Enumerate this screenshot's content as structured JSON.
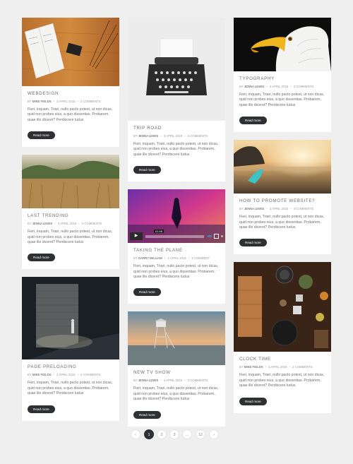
{
  "posts": [
    {
      "title": "Webdesign",
      "author": "MIKE FIELDS",
      "date": "3 APRIL 2015",
      "comments": "2 COMMENTS",
      "excerpt": "Fieri, inquam, Triari, nullo pacto potest, ut non dicas, quid non probes eius, a quo dissentias. Probarem, quae ille diceret? Perdiscere ludus",
      "button": "Read more"
    },
    {
      "title": "Last Trending",
      "author": "JENNA LEWIS",
      "date": "3 APRIL 2015",
      "comments": "3 COMMENTS",
      "excerpt": "Fieri, inquam, Triari, nullo pacto potest, ut non dicas, quid non probes eius, a quo dissentias. Probarem, quae ille diceret? Perdiscere ludus",
      "button": "Read more"
    },
    {
      "title": "Page Preloading",
      "author": "MIKE FIELDS",
      "date": "3 APRIL 2015",
      "comments": "2 COMMENTS",
      "excerpt": "Fieri, inquam, Triari, nullo pacto potest, ut non dicas, quid non probes eius, a quo dissentias. Probarem, quae ille diceret? Perdiscere ludus",
      "button": "Read more"
    },
    {
      "title": "Trip Road",
      "author": "JENNA LEWIS",
      "date": "3 APRIL 2015",
      "comments": "3 COMMENTS",
      "excerpt": "Fieri, inquam, Triari, nullo pacto potest, ut non dicas, quid non probes eius, a quo dissentias. Probarem, quae ille diceret? Perdiscere ludus",
      "button": "Read more"
    },
    {
      "title": "Taking the Plane",
      "author": "GARRY WILLIAM",
      "date": "2 APRIL 2015",
      "comments": "1 COMMENT",
      "excerpt": "Fieri, inquam, Triari, nullo pacto potest, ut non dicas, quid non probes eius, a quo dissentias. Probarem, quae ille diceret? Perdiscere ludus",
      "button": "Read more",
      "video": {
        "time": "01:45"
      }
    },
    {
      "title": "New TV Show",
      "author": "JENNA LEWIS",
      "date": "3 APRIL 2015",
      "comments": "3 COMMENTS",
      "excerpt": "Fieri, inquam, Triari, nullo pacto potest, ut non dicas, quid non probes eius, a quo dissentias. Probarem, quae ille diceret? Perdiscere ludus",
      "button": "Read more"
    },
    {
      "title": "Typography",
      "author": "JENNA LEWIS",
      "date": "3 APRIL 2015",
      "comments": "3 COMMENTS",
      "excerpt": "Fieri, inquam, Triari, nullo pacto potest, ut non dicas, quid non probes eius, a quo dissentias. Probarem, quae ille diceret? Perdiscere ludus",
      "button": "Read more"
    },
    {
      "title": "How to Promote Website?",
      "author": "JENNA LEWIS",
      "date": "3 APRIL 2015",
      "comments": "3 COMMENTS",
      "excerpt": "Fieri, inquam, Triari, nullo pacto potest, ut non dicas, quid non probes eius, a quo dissentias. Probarem, quae ille diceret? Perdiscere ludus",
      "button": "Read more"
    },
    {
      "title": "Clock Time",
      "author": "MIKE FIELDS",
      "date": "3 APRIL 2015",
      "comments": "2 COMMENTS",
      "excerpt": "Fieri, inquam, Triari, nullo pacto potest, ut non dicas, quid non probes eius, a quo dissentias. Probarem, quae ille diceret? Perdiscere ludus",
      "button": "Read more"
    }
  ],
  "meta_by": "BY",
  "meta_sep": "•",
  "pagination": {
    "prev": "‹",
    "pages": [
      "1",
      "2",
      "3",
      "...",
      "12"
    ],
    "next": "›",
    "active": "1"
  },
  "colors": {
    "accent": "#2e3033",
    "background": "#efefef"
  }
}
